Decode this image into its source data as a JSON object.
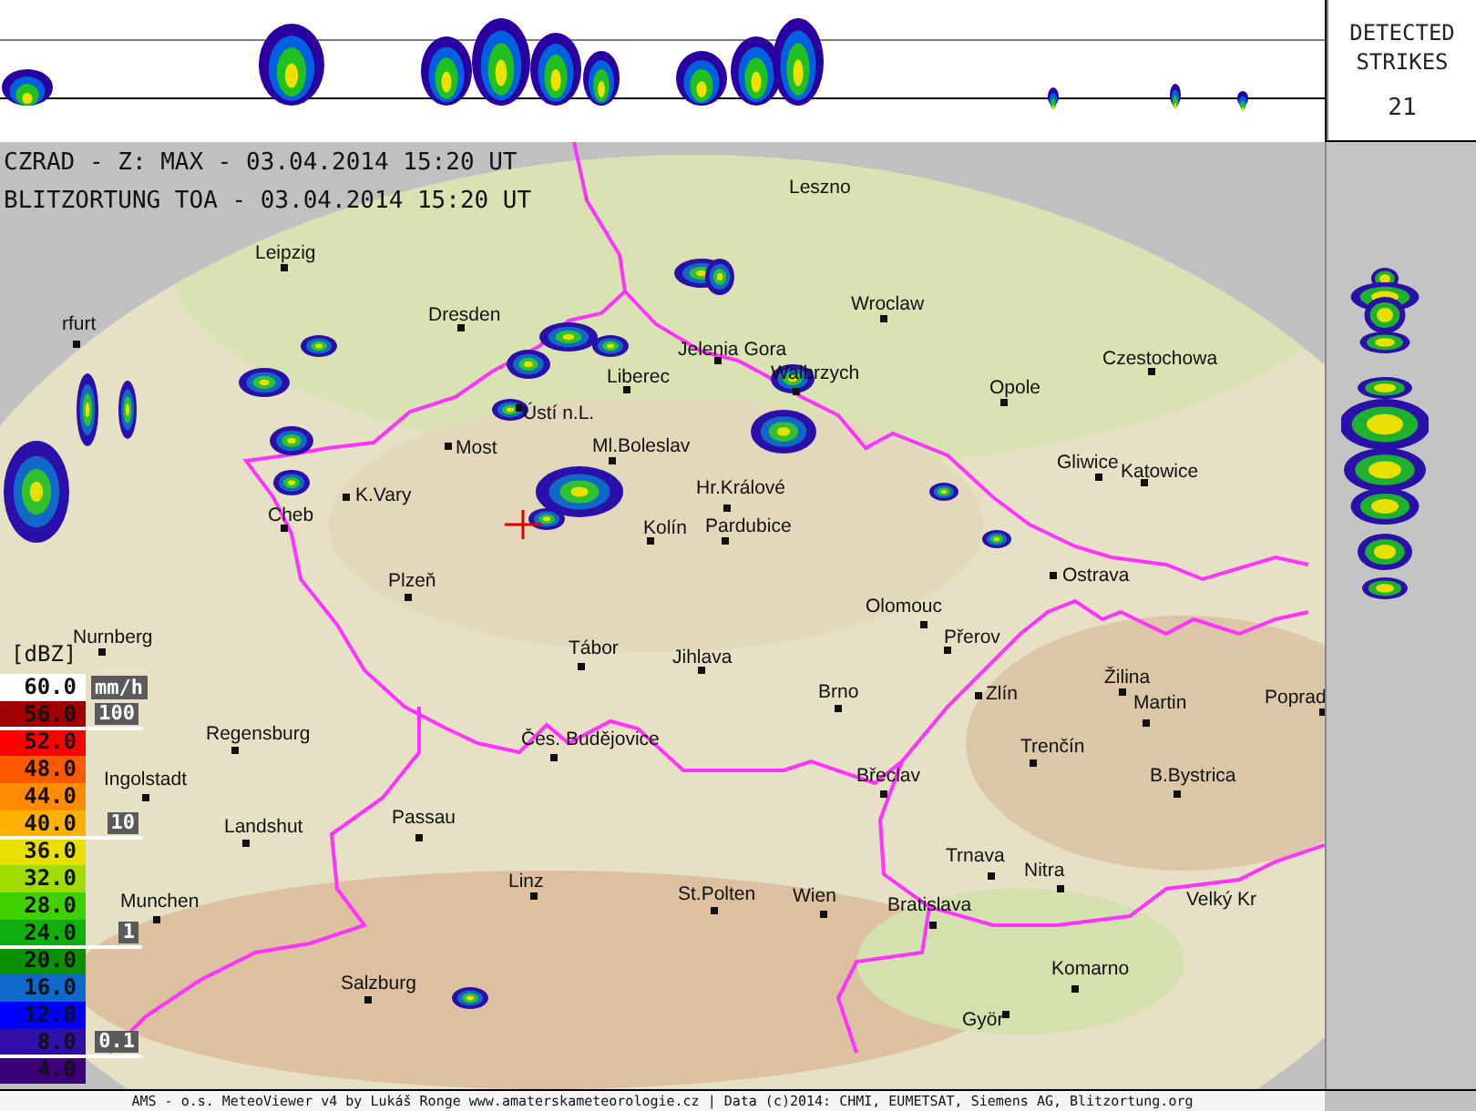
{
  "header": {
    "lines": [
      "CZRAD - Z: MAX - 03.04.2014 15:20 UT",
      "BLITZORTUNG TOA - 03.04.2014 15:20 UT"
    ]
  },
  "strikes": {
    "title": "DETECTED STRIKES",
    "count": "21"
  },
  "cities": [
    {
      "name": "Leszno"
    },
    {
      "name": "Leipzig"
    },
    {
      "name": "Dresden"
    },
    {
      "name": "rfurt"
    },
    {
      "name": "Wroclaw"
    },
    {
      "name": "Jelenia Gora"
    },
    {
      "name": "Liberec"
    },
    {
      "name": "Walbrzych"
    },
    {
      "name": "Opole"
    },
    {
      "name": "Czestochowa"
    },
    {
      "name": "Ústí n.L."
    },
    {
      "name": "Most"
    },
    {
      "name": "Ml.Boleslav"
    },
    {
      "name": "Gliwice"
    },
    {
      "name": "Katowice"
    },
    {
      "name": "K.Vary"
    },
    {
      "name": "Hr.Králové"
    },
    {
      "name": "Cheb"
    },
    {
      "name": "Kolín"
    },
    {
      "name": "Pardubice"
    },
    {
      "name": "Ostrava"
    },
    {
      "name": "Plzeň"
    },
    {
      "name": "Olomouc"
    },
    {
      "name": "Nurnberg"
    },
    {
      "name": "Přerov"
    },
    {
      "name": "Tábor"
    },
    {
      "name": "Jihlava"
    },
    {
      "name": "Žilina"
    },
    {
      "name": "Brno"
    },
    {
      "name": "Zlín"
    },
    {
      "name": "Martin"
    },
    {
      "name": "Poprad"
    },
    {
      "name": "Regensburg"
    },
    {
      "name": "Čes. Budějovice"
    },
    {
      "name": "Trenčín"
    },
    {
      "name": "Ingolstadt"
    },
    {
      "name": "Břeclav"
    },
    {
      "name": "B.Bystrica"
    },
    {
      "name": "Landshut"
    },
    {
      "name": "Passau"
    },
    {
      "name": "Trnava"
    },
    {
      "name": "Munchen"
    },
    {
      "name": "Linz"
    },
    {
      "name": "Nitra"
    },
    {
      "name": "St.Polten"
    },
    {
      "name": "Wien"
    },
    {
      "name": "Bratislava"
    },
    {
      "name": "Velký Kr"
    },
    {
      "name": "Komarno"
    },
    {
      "name": "Salzburg"
    },
    {
      "name": "Györ"
    }
  ],
  "legend": {
    "unit": "[dBZ]",
    "rate_unit": "mm/h",
    "levels": [
      {
        "label": "60.0",
        "color": "#ffffff"
      },
      {
        "label": "56.0",
        "color": "#a00000"
      },
      {
        "label": "52.0",
        "color": "#ff0000"
      },
      {
        "label": "48.0",
        "color": "#ff5a00"
      },
      {
        "label": "44.0",
        "color": "#ff8c00"
      },
      {
        "label": "40.0",
        "color": "#ffb000"
      },
      {
        "label": "36.0",
        "color": "#e8e000"
      },
      {
        "label": "32.0",
        "color": "#a0dc00"
      },
      {
        "label": "28.0",
        "color": "#40d000"
      },
      {
        "label": "24.0",
        "color": "#10b010"
      },
      {
        "label": "20.0",
        "color": "#0a9000"
      },
      {
        "label": "16.0",
        "color": "#1068c8"
      },
      {
        "label": "12.0",
        "color": "#0000ff"
      },
      {
        "label": "8.0",
        "color": "#3010a8"
      },
      {
        "label": "4.0",
        "color": "#3c0078"
      }
    ],
    "rate_marks": [
      "100",
      "10",
      "1",
      "0.1"
    ]
  },
  "footer": {
    "text": "AMS - o.s. MeteoViewer v4 by Lukáš Ronge www.amaterskameteorologie.cz | Data (c)2014: CHMI, EUMETSAT, Siemens AG, Blitzortung.org"
  }
}
